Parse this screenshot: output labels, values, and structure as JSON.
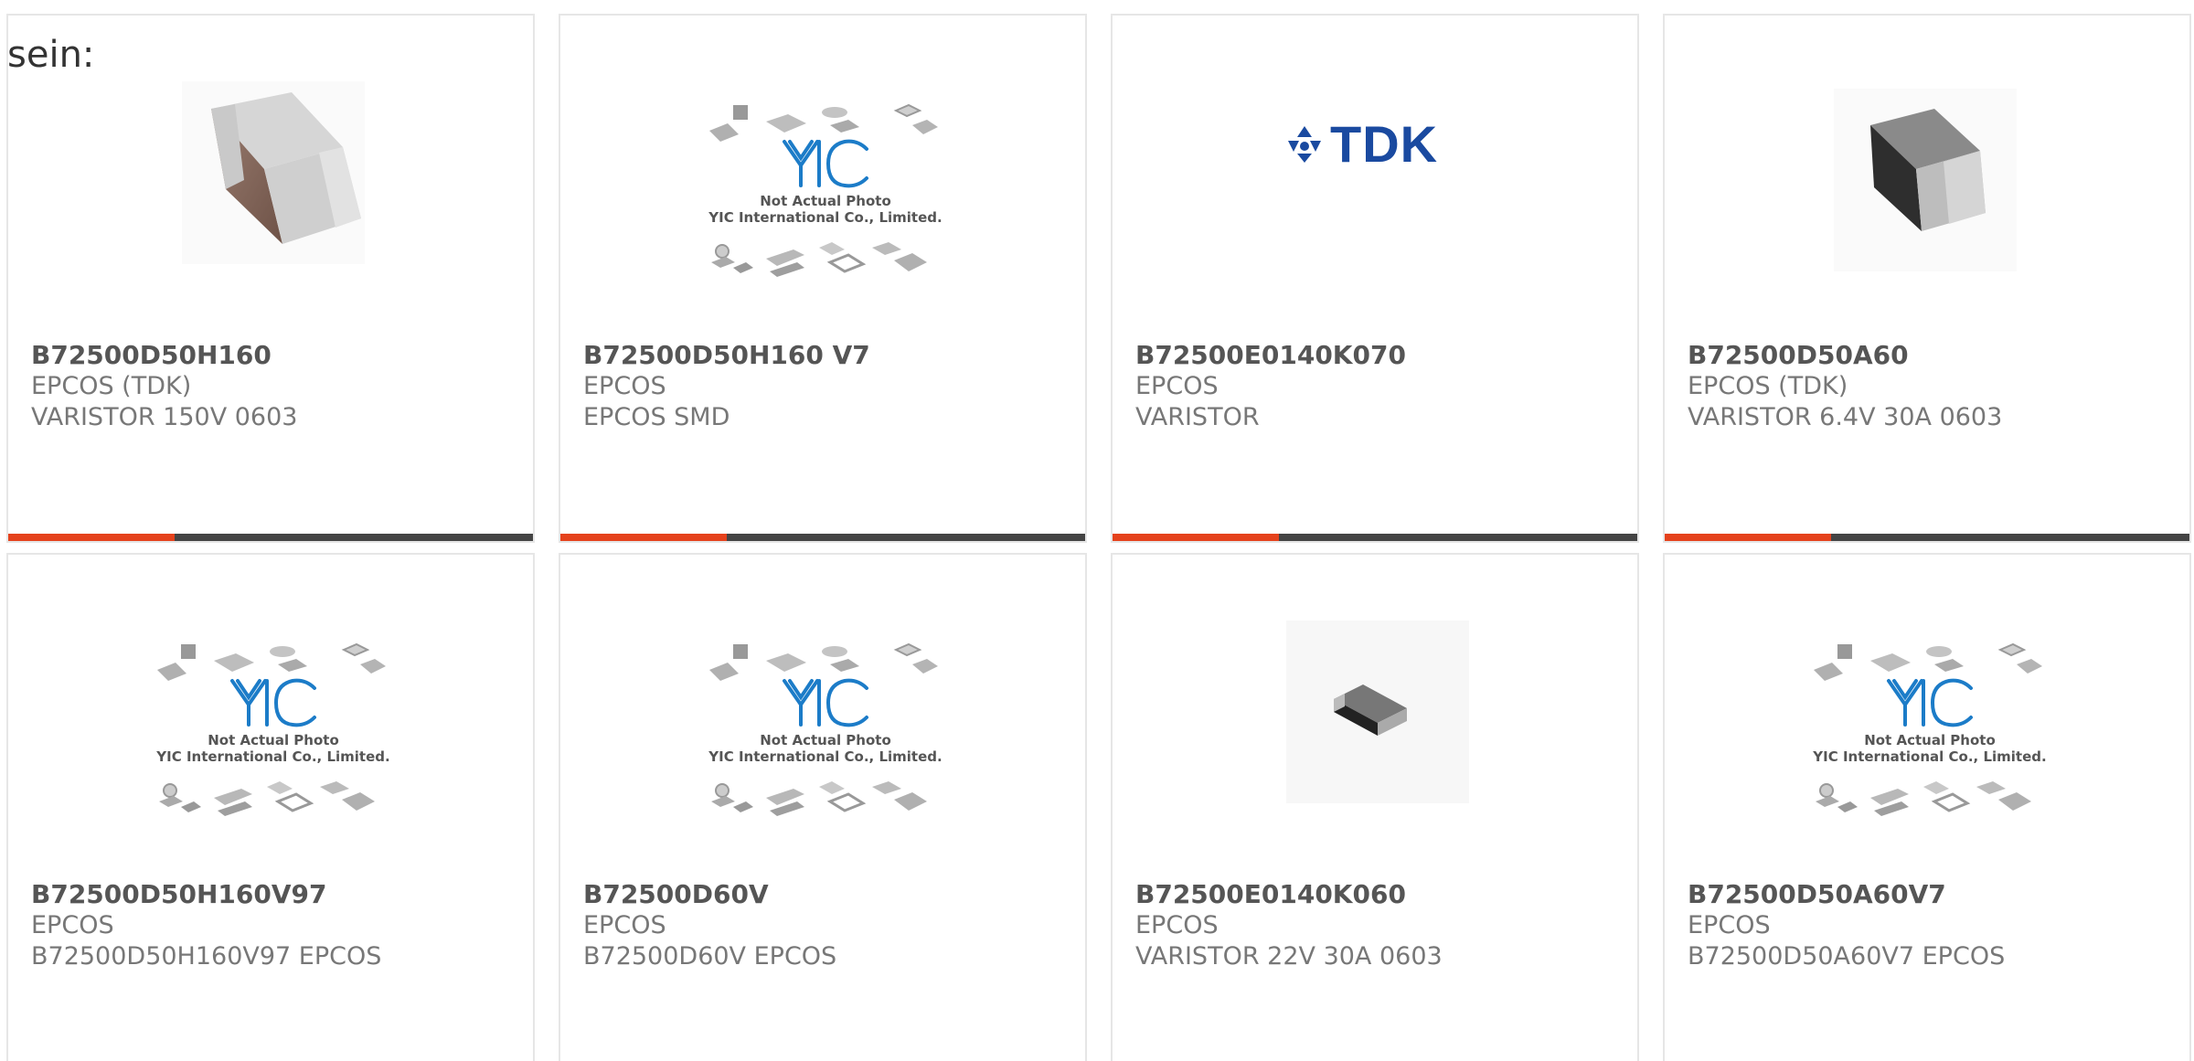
{
  "heading_fragment": "sein:",
  "colors": {
    "accent": "#e5421c",
    "bar": "#444444",
    "title": "#555555",
    "text": "#777777",
    "card_border": "#e6e6e6",
    "tdk_blue": "#1a4aa0",
    "yic_blue": "#1c7cc8"
  },
  "placeholder": {
    "caption_line1": "Not Actual Photo",
    "caption_line2": "YIC International Co., Limited."
  },
  "tdk_logo_text": "TDK",
  "products": [
    {
      "part": "B72500D50H160",
      "maker": "EPCOS (TDK)",
      "desc": "VARISTOR 150V 0603",
      "image": "brown-capacitor-photo"
    },
    {
      "part": "B72500D50H160 V7",
      "maker": "EPCOS",
      "desc": "EPCOS SMD",
      "image": "yic-placeholder"
    },
    {
      "part": "B72500E0140K070",
      "maker": "EPCOS",
      "desc": "VARISTOR",
      "image": "tdk-logo"
    },
    {
      "part": "B72500D50A60",
      "maker": "EPCOS (TDK)",
      "desc": "VARISTOR 6.4V 30A 0603",
      "image": "black-chip-photo"
    },
    {
      "part": "B72500D50H160V97",
      "maker": "EPCOS",
      "desc": "B72500D50H160V97 EPCOS",
      "image": "yic-placeholder"
    },
    {
      "part": "B72500D60V",
      "maker": "EPCOS",
      "desc": "B72500D60V EPCOS",
      "image": "yic-placeholder"
    },
    {
      "part": "B72500E0140K060",
      "maker": "EPCOS",
      "desc": "VARISTOR 22V 30A 0603",
      "image": "small-black-chip-photo"
    },
    {
      "part": "B72500D50A60V7",
      "maker": "EPCOS",
      "desc": "B72500D50A60V7 EPCOS",
      "image": "yic-placeholder"
    }
  ]
}
